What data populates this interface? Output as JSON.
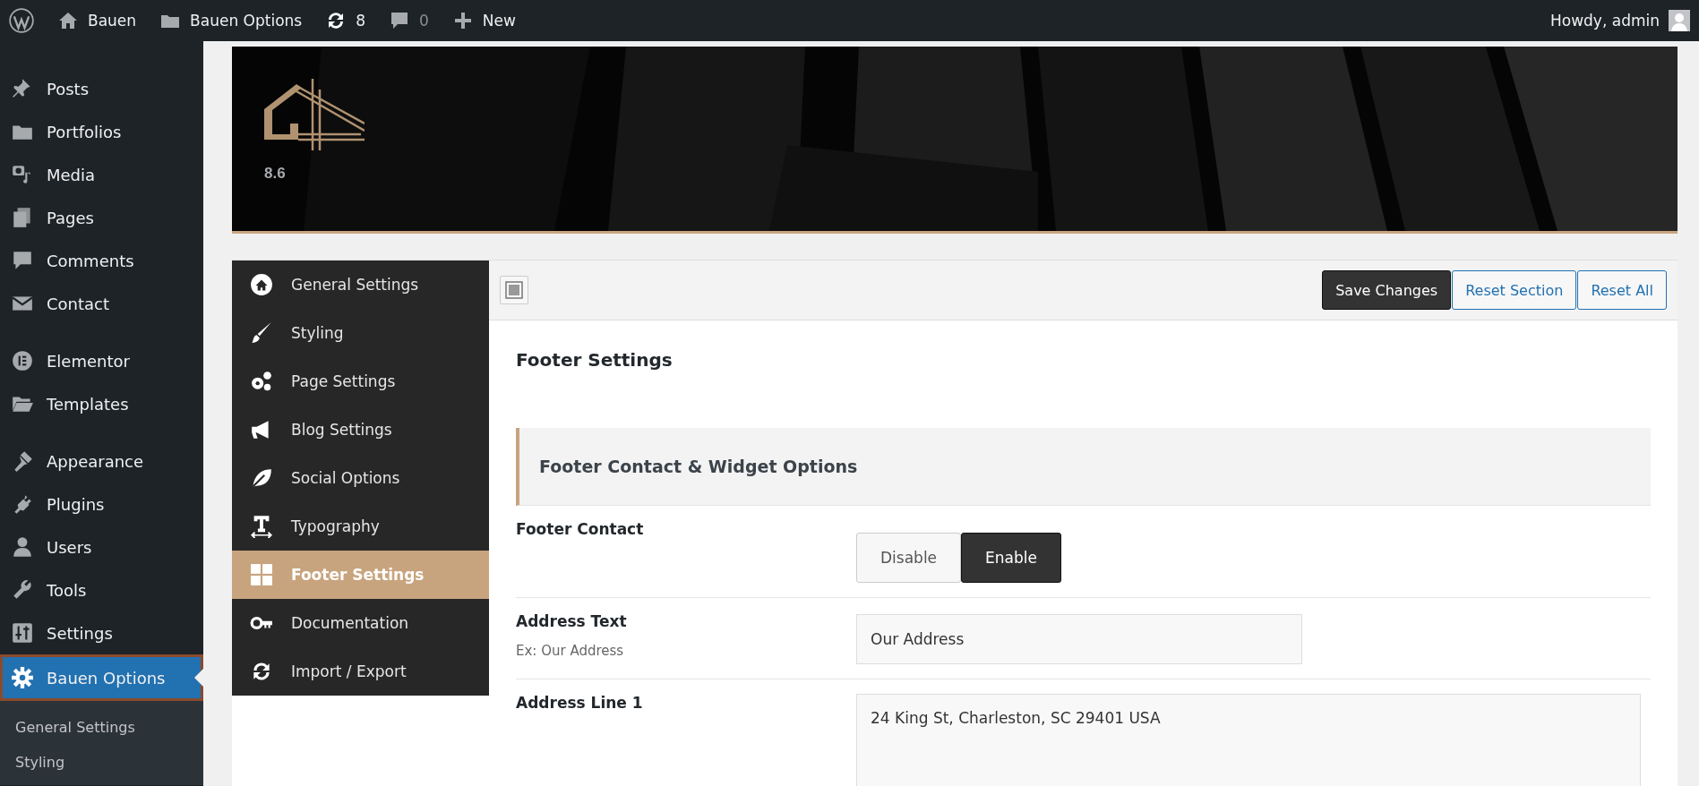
{
  "admin_bar": {
    "site": "Bauen",
    "options": "Bauen Options",
    "updates": "8",
    "comments": "0",
    "new": "New",
    "greeting": "Howdy, admin"
  },
  "admin_menu": {
    "groups": [
      [
        {
          "label": "Posts",
          "selected": false
        },
        {
          "label": "Portfolios",
          "selected": false
        },
        {
          "label": "Media",
          "selected": false
        },
        {
          "label": "Pages",
          "selected": false
        },
        {
          "label": "Comments",
          "selected": false
        },
        {
          "label": "Contact",
          "selected": false
        }
      ],
      [
        {
          "label": "Elementor",
          "selected": false
        },
        {
          "label": "Templates",
          "selected": false
        }
      ],
      [
        {
          "label": "Appearance",
          "selected": false
        },
        {
          "label": "Plugins",
          "selected": false
        },
        {
          "label": "Users",
          "selected": false
        },
        {
          "label": "Tools",
          "selected": false
        },
        {
          "label": "Settings",
          "selected": false
        },
        {
          "label": "Bauen Options",
          "selected": true
        }
      ]
    ],
    "submenu": [
      "General Settings",
      "Styling"
    ]
  },
  "banner": {
    "version": "8.6"
  },
  "options_nav": [
    {
      "label": "General Settings",
      "selected": false
    },
    {
      "label": "Styling",
      "selected": false
    },
    {
      "label": "Page Settings",
      "selected": false
    },
    {
      "label": "Blog Settings",
      "selected": false
    },
    {
      "label": "Social Options",
      "selected": false
    },
    {
      "label": "Typography",
      "selected": false
    },
    {
      "label": "Footer Settings",
      "selected": true
    },
    {
      "label": "Documentation",
      "selected": false
    },
    {
      "label": "Import / Export",
      "selected": false
    }
  ],
  "toolbar": {
    "buttons": [
      {
        "label": "Save Changes",
        "kind": "primary"
      },
      {
        "label": "Reset Section",
        "kind": "secondary"
      },
      {
        "label": "Reset All",
        "kind": "secondary"
      }
    ]
  },
  "page_title": "Footer Settings",
  "section_title": "Footer Contact & Widget Options",
  "fields": [
    {
      "kind": "toggle",
      "label": "Footer Contact",
      "options": [
        {
          "label": "Disable",
          "selected": false
        },
        {
          "label": "Enable",
          "selected": true
        }
      ]
    },
    {
      "kind": "text",
      "label": "Address Text",
      "description": "Ex: Our Address",
      "value": "Our Address"
    },
    {
      "kind": "textarea",
      "label": "Address Line 1",
      "value": "24 King St, Charleston, SC 29401 USA"
    }
  ]
}
